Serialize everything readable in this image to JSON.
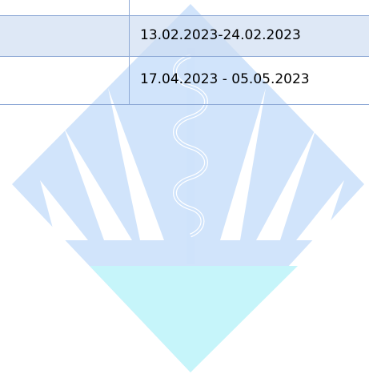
{
  "table": {
    "rows": [
      {
        "date_range": "13.02.2023-24.02.2023"
      },
      {
        "date_range": "17.04.2023 - 05.05.2023"
      }
    ]
  },
  "colors": {
    "border": "#8faad6",
    "header_row_fill": "#cddcf1",
    "watermark_blue": "#cfe3fb",
    "watermark_cyan": "#c6f5fa"
  }
}
